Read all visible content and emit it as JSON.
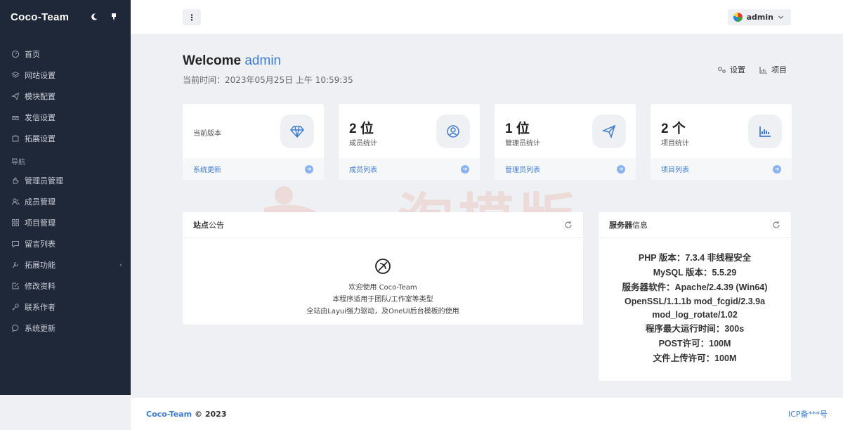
{
  "app": {
    "name": "Coco-Team"
  },
  "sidebar": {
    "items_top": [
      {
        "label": "首页",
        "icon": "dashboard-icon"
      },
      {
        "label": "网站设置",
        "icon": "layers-icon"
      },
      {
        "label": "模块配置",
        "icon": "send-icon"
      },
      {
        "label": "发信设置",
        "icon": "mail-icon"
      },
      {
        "label": "拓展设置",
        "icon": "puzzle-icon"
      }
    ],
    "section_label": "导航",
    "items_nav": [
      {
        "label": "管理员管理",
        "icon": "hand-icon"
      },
      {
        "label": "成员管理",
        "icon": "users-icon"
      },
      {
        "label": "项目管理",
        "icon": "grid-icon"
      },
      {
        "label": "留言列表",
        "icon": "comment-icon"
      },
      {
        "label": "拓展功能",
        "icon": "wrench-icon",
        "arrow": "‹"
      },
      {
        "label": "修改资料",
        "icon": "edit-icon"
      },
      {
        "label": "联系作者",
        "icon": "key-icon"
      },
      {
        "label": "系统更新",
        "icon": "chat-icon"
      }
    ]
  },
  "topbar": {
    "menu_glyph": "⋮",
    "user": "admin"
  },
  "welcome": {
    "prefix": "Welcome",
    "user": "admin",
    "time": "当前时间：2023年05月25日 上午 10:59:35"
  },
  "top_actions": {
    "settings": "设置",
    "projects": "项目"
  },
  "cards": [
    {
      "value": "",
      "label": "当前版本",
      "link": "系统更新",
      "icon": "diamond-icon"
    },
    {
      "value": "2 位",
      "label": "成员统计",
      "link": "成员列表",
      "icon": "user-circle-icon"
    },
    {
      "value": "1 位",
      "label": "管理员统计",
      "link": "管理员列表",
      "icon": "paper-plane-icon"
    },
    {
      "value": "2 个",
      "label": "项目统计",
      "link": "项目列表",
      "icon": "bar-chart-icon"
    }
  ],
  "notice": {
    "title_bold": "站点",
    "title_rest": "公告",
    "lines": [
      "欢迎使用 Coco-Team",
      "本程序适用于团队/工作室等类型",
      "全站由Layui强力驱动，及OneUI后台模板的使用"
    ]
  },
  "server": {
    "title_bold": "服务器",
    "title_rest": "信息",
    "lines": [
      "PHP 版本：7.3.4 非线程安全",
      "MySQL 版本：5.5.29",
      "服务器软件：Apache/2.4.39 (Win64)",
      "OpenSSL/1.1.1b mod_fcgid/2.3.9a",
      "mod_log_rotate/1.02",
      "程序最大运行时间：300s",
      "POST许可：100M",
      "文件上传许可：100M"
    ]
  },
  "watermark": {
    "text": "一淘模版"
  },
  "footer": {
    "brand": "Coco-Team",
    "copy": "© 2023",
    "icp": "ICP备***号"
  }
}
